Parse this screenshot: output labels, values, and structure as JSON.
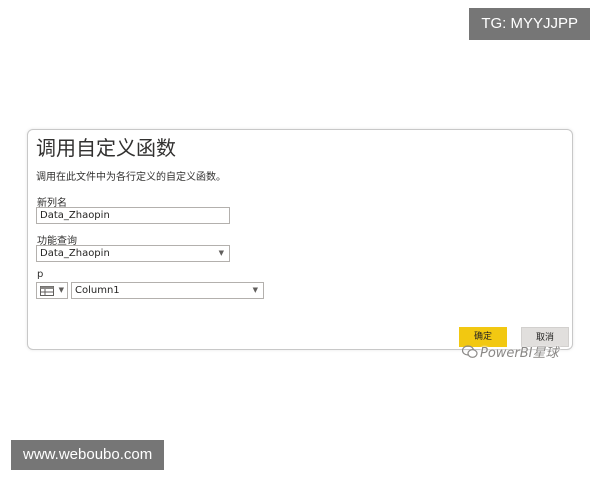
{
  "top_badge": {
    "text": "TG: MYYJJPP"
  },
  "bottom_badge": {
    "text": "www.weboubo.com"
  },
  "dialog": {
    "title": "调用自定义函数",
    "description": "调用在此文件中为各行定义的自定义函数。",
    "new_column": {
      "label": "新列名",
      "value": "Data_Zhaopin"
    },
    "function_query": {
      "label": "功能查询",
      "value": "Data_Zhaopin"
    },
    "parameter": {
      "label": "p",
      "type_icon": "table-icon",
      "value": "Column1"
    },
    "ok_label": "确定",
    "cancel_label": "取消",
    "ok_color": "#F2C811"
  },
  "watermark": {
    "text": "PowerBI星球",
    "icon": "wechat-icon"
  }
}
